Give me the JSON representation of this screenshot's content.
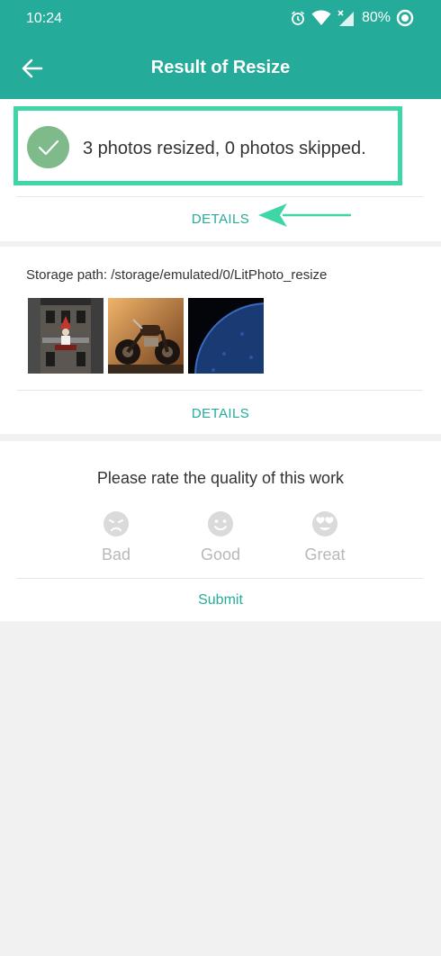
{
  "status_bar": {
    "time": "10:24",
    "battery": "80%"
  },
  "header": {
    "title": "Result of Resize"
  },
  "result": {
    "summary": "3 photos resized, 0 photos skipped.",
    "details_label": "DETAILS"
  },
  "storage": {
    "label": "Storage path:",
    "path": "/storage/emulated/0/LitPhoto_resize",
    "details_label": "DETAILS"
  },
  "rating": {
    "question": "Please rate the quality of this work",
    "options": [
      {
        "label": "Bad",
        "icon": "sad-face-icon"
      },
      {
        "label": "Good",
        "icon": "smile-face-icon"
      },
      {
        "label": "Great",
        "icon": "heart-eyes-face-icon"
      }
    ],
    "submit_label": "Submit"
  },
  "colors": {
    "accent": "#25ab99",
    "highlight": "#3fd6a7",
    "check": "#7fba8b"
  }
}
